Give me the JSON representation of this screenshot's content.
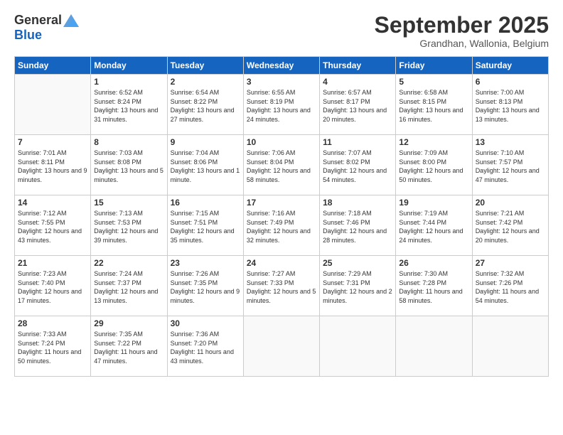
{
  "logo": {
    "general": "General",
    "blue": "Blue"
  },
  "title": "September 2025",
  "location": "Grandhan, Wallonia, Belgium",
  "days_header": [
    "Sunday",
    "Monday",
    "Tuesday",
    "Wednesday",
    "Thursday",
    "Friday",
    "Saturday"
  ],
  "weeks": [
    [
      {
        "day": "",
        "sunrise": "",
        "sunset": "",
        "daylight": ""
      },
      {
        "day": "1",
        "sunrise": "Sunrise: 6:52 AM",
        "sunset": "Sunset: 8:24 PM",
        "daylight": "Daylight: 13 hours and 31 minutes."
      },
      {
        "day": "2",
        "sunrise": "Sunrise: 6:54 AM",
        "sunset": "Sunset: 8:22 PM",
        "daylight": "Daylight: 13 hours and 27 minutes."
      },
      {
        "day": "3",
        "sunrise": "Sunrise: 6:55 AM",
        "sunset": "Sunset: 8:19 PM",
        "daylight": "Daylight: 13 hours and 24 minutes."
      },
      {
        "day": "4",
        "sunrise": "Sunrise: 6:57 AM",
        "sunset": "Sunset: 8:17 PM",
        "daylight": "Daylight: 13 hours and 20 minutes."
      },
      {
        "day": "5",
        "sunrise": "Sunrise: 6:58 AM",
        "sunset": "Sunset: 8:15 PM",
        "daylight": "Daylight: 13 hours and 16 minutes."
      },
      {
        "day": "6",
        "sunrise": "Sunrise: 7:00 AM",
        "sunset": "Sunset: 8:13 PM",
        "daylight": "Daylight: 13 hours and 13 minutes."
      }
    ],
    [
      {
        "day": "7",
        "sunrise": "Sunrise: 7:01 AM",
        "sunset": "Sunset: 8:11 PM",
        "daylight": "Daylight: 13 hours and 9 minutes."
      },
      {
        "day": "8",
        "sunrise": "Sunrise: 7:03 AM",
        "sunset": "Sunset: 8:08 PM",
        "daylight": "Daylight: 13 hours and 5 minutes."
      },
      {
        "day": "9",
        "sunrise": "Sunrise: 7:04 AM",
        "sunset": "Sunset: 8:06 PM",
        "daylight": "Daylight: 13 hours and 1 minute."
      },
      {
        "day": "10",
        "sunrise": "Sunrise: 7:06 AM",
        "sunset": "Sunset: 8:04 PM",
        "daylight": "Daylight: 12 hours and 58 minutes."
      },
      {
        "day": "11",
        "sunrise": "Sunrise: 7:07 AM",
        "sunset": "Sunset: 8:02 PM",
        "daylight": "Daylight: 12 hours and 54 minutes."
      },
      {
        "day": "12",
        "sunrise": "Sunrise: 7:09 AM",
        "sunset": "Sunset: 8:00 PM",
        "daylight": "Daylight: 12 hours and 50 minutes."
      },
      {
        "day": "13",
        "sunrise": "Sunrise: 7:10 AM",
        "sunset": "Sunset: 7:57 PM",
        "daylight": "Daylight: 12 hours and 47 minutes."
      }
    ],
    [
      {
        "day": "14",
        "sunrise": "Sunrise: 7:12 AM",
        "sunset": "Sunset: 7:55 PM",
        "daylight": "Daylight: 12 hours and 43 minutes."
      },
      {
        "day": "15",
        "sunrise": "Sunrise: 7:13 AM",
        "sunset": "Sunset: 7:53 PM",
        "daylight": "Daylight: 12 hours and 39 minutes."
      },
      {
        "day": "16",
        "sunrise": "Sunrise: 7:15 AM",
        "sunset": "Sunset: 7:51 PM",
        "daylight": "Daylight: 12 hours and 35 minutes."
      },
      {
        "day": "17",
        "sunrise": "Sunrise: 7:16 AM",
        "sunset": "Sunset: 7:49 PM",
        "daylight": "Daylight: 12 hours and 32 minutes."
      },
      {
        "day": "18",
        "sunrise": "Sunrise: 7:18 AM",
        "sunset": "Sunset: 7:46 PM",
        "daylight": "Daylight: 12 hours and 28 minutes."
      },
      {
        "day": "19",
        "sunrise": "Sunrise: 7:19 AM",
        "sunset": "Sunset: 7:44 PM",
        "daylight": "Daylight: 12 hours and 24 minutes."
      },
      {
        "day": "20",
        "sunrise": "Sunrise: 7:21 AM",
        "sunset": "Sunset: 7:42 PM",
        "daylight": "Daylight: 12 hours and 20 minutes."
      }
    ],
    [
      {
        "day": "21",
        "sunrise": "Sunrise: 7:23 AM",
        "sunset": "Sunset: 7:40 PM",
        "daylight": "Daylight: 12 hours and 17 minutes."
      },
      {
        "day": "22",
        "sunrise": "Sunrise: 7:24 AM",
        "sunset": "Sunset: 7:37 PM",
        "daylight": "Daylight: 12 hours and 13 minutes."
      },
      {
        "day": "23",
        "sunrise": "Sunrise: 7:26 AM",
        "sunset": "Sunset: 7:35 PM",
        "daylight": "Daylight: 12 hours and 9 minutes."
      },
      {
        "day": "24",
        "sunrise": "Sunrise: 7:27 AM",
        "sunset": "Sunset: 7:33 PM",
        "daylight": "Daylight: 12 hours and 5 minutes."
      },
      {
        "day": "25",
        "sunrise": "Sunrise: 7:29 AM",
        "sunset": "Sunset: 7:31 PM",
        "daylight": "Daylight: 12 hours and 2 minutes."
      },
      {
        "day": "26",
        "sunrise": "Sunrise: 7:30 AM",
        "sunset": "Sunset: 7:28 PM",
        "daylight": "Daylight: 11 hours and 58 minutes."
      },
      {
        "day": "27",
        "sunrise": "Sunrise: 7:32 AM",
        "sunset": "Sunset: 7:26 PM",
        "daylight": "Daylight: 11 hours and 54 minutes."
      }
    ],
    [
      {
        "day": "28",
        "sunrise": "Sunrise: 7:33 AM",
        "sunset": "Sunset: 7:24 PM",
        "daylight": "Daylight: 11 hours and 50 minutes."
      },
      {
        "day": "29",
        "sunrise": "Sunrise: 7:35 AM",
        "sunset": "Sunset: 7:22 PM",
        "daylight": "Daylight: 11 hours and 47 minutes."
      },
      {
        "day": "30",
        "sunrise": "Sunrise: 7:36 AM",
        "sunset": "Sunset: 7:20 PM",
        "daylight": "Daylight: 11 hours and 43 minutes."
      },
      {
        "day": "",
        "sunrise": "",
        "sunset": "",
        "daylight": ""
      },
      {
        "day": "",
        "sunrise": "",
        "sunset": "",
        "daylight": ""
      },
      {
        "day": "",
        "sunrise": "",
        "sunset": "",
        "daylight": ""
      },
      {
        "day": "",
        "sunrise": "",
        "sunset": "",
        "daylight": ""
      }
    ]
  ]
}
